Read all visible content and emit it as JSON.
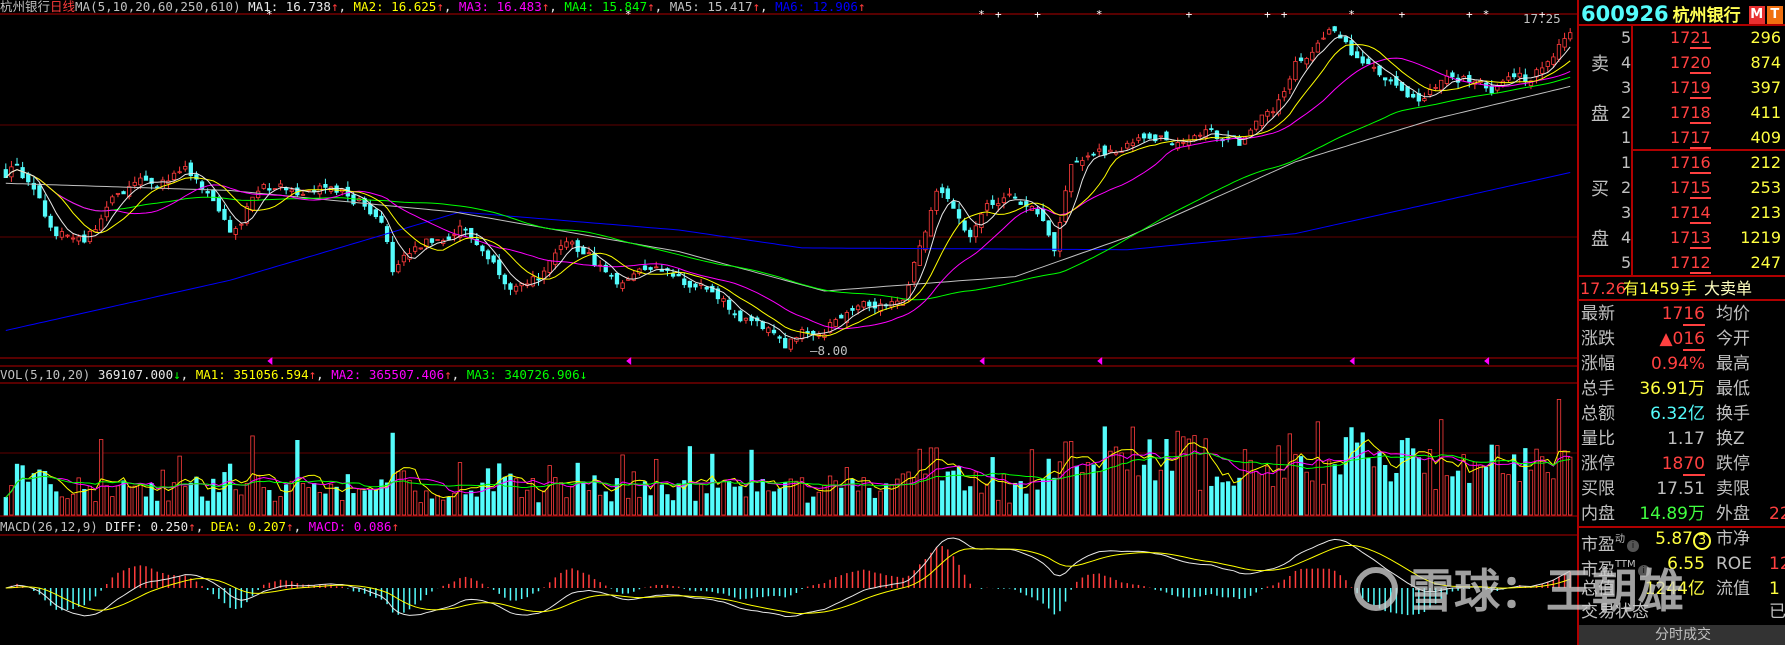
{
  "main_header": {
    "stock_name": "杭州银行",
    "period": "日线",
    "ma_params": "MA(5,10,20,60,250,610)",
    "items": [
      {
        "label": "MA1: ",
        "value": "16.738",
        "arrow": "↑",
        "color": "#e8e8e8"
      },
      {
        "label": "MA2: ",
        "value": "16.625",
        "arrow": "↑",
        "color": "#ffff00"
      },
      {
        "label": "MA3: ",
        "value": "16.483",
        "arrow": "↑",
        "color": "#ff00ff"
      },
      {
        "label": "MA4: ",
        "value": "15.847",
        "arrow": "↑",
        "color": "#00ff00"
      },
      {
        "label": "MA5: ",
        "value": "15.417",
        "arrow": "↑",
        "color": "#c0c0c0"
      },
      {
        "label": "MA6: ",
        "value": "12.906",
        "arrow": "↑",
        "color": "#0000ff"
      }
    ],
    "high_label": "17.25",
    "low_label": "8.00"
  },
  "vol_header": {
    "params": "VOL(5,10,20)",
    "value": "369107.000",
    "value_arrow": "↓",
    "items": [
      {
        "label": "MA1: ",
        "value": "351056.594",
        "arrow": "↑",
        "color": "#ffff00"
      },
      {
        "label": "MA2: ",
        "value": "365507.406",
        "arrow": "↑",
        "color": "#ff00ff"
      },
      {
        "label": "MA3: ",
        "value": "340726.906",
        "arrow": "↓",
        "color": "#00ff00"
      }
    ]
  },
  "macd_header": {
    "params": "MACD(26,12,9)",
    "items": [
      {
        "label": "DIFF: ",
        "value": "0.250",
        "arrow": "↑",
        "color": "#e8e8e8"
      },
      {
        "label": "DEA: ",
        "value": "0.207",
        "arrow": "↑",
        "color": "#ffff00"
      },
      {
        "label": "MACD: ",
        "value": "0.086",
        "arrow": "↑",
        "color": "#ff00ff"
      }
    ]
  },
  "chart_data": {
    "type": "candlestick",
    "bars": 280,
    "price_min": 8.0,
    "price_max": 17.25,
    "close_keypoints": [
      [
        0,
        13.0
      ],
      [
        2,
        13.3
      ],
      [
        8,
        11.4
      ],
      [
        14,
        10.95
      ],
      [
        20,
        12.4
      ],
      [
        32,
        13.0
      ],
      [
        40,
        11.4
      ],
      [
        46,
        12.7
      ],
      [
        58,
        12.5
      ],
      [
        67,
        11.9
      ],
      [
        69,
        10.3
      ],
      [
        81,
        11.6
      ],
      [
        89,
        10.15
      ],
      [
        93,
        9.7
      ],
      [
        101,
        10.95
      ],
      [
        109,
        10.0
      ],
      [
        115,
        10.5
      ],
      [
        125,
        9.7
      ],
      [
        133,
        8.7
      ],
      [
        139,
        8.25
      ],
      [
        146,
        8.7
      ],
      [
        152,
        9.5
      ],
      [
        160,
        9.5
      ],
      [
        166,
        12.5
      ],
      [
        172,
        11.4
      ],
      [
        178,
        12.5
      ],
      [
        184,
        11.9
      ],
      [
        187,
        10.95
      ],
      [
        190,
        13.3
      ],
      [
        202,
        13.8
      ],
      [
        214,
        14.1
      ],
      [
        220,
        13.8
      ],
      [
        226,
        14.6
      ],
      [
        230,
        16.0
      ],
      [
        236,
        16.8
      ],
      [
        241,
        16.2
      ],
      [
        251,
        14.9
      ],
      [
        257,
        15.7
      ],
      [
        265,
        15.4
      ],
      [
        271,
        15.5
      ],
      [
        276,
        16.5
      ],
      [
        279,
        17.0
      ]
    ],
    "ma250_keypoints": [
      [
        0,
        12.7
      ],
      [
        40,
        12.5
      ],
      [
        80,
        11.9
      ],
      [
        120,
        10.8
      ],
      [
        146,
        9.7
      ],
      [
        180,
        10.1
      ],
      [
        200,
        11.2
      ],
      [
        230,
        13.3
      ],
      [
        255,
        14.5
      ],
      [
        279,
        15.4
      ]
    ],
    "ma610_keypoints": [
      [
        0,
        8.6
      ],
      [
        40,
        10.0
      ],
      [
        81,
        11.9
      ],
      [
        120,
        11.4
      ],
      [
        142,
        10.9
      ],
      [
        200,
        10.85
      ],
      [
        230,
        11.3
      ],
      [
        279,
        13.0
      ]
    ],
    "top_markers": [
      [
        47,
        "*"
      ],
      [
        111,
        "*"
      ],
      [
        174,
        "*"
      ],
      [
        177,
        "+"
      ],
      [
        184,
        "+"
      ],
      [
        195,
        "*"
      ],
      [
        211,
        "+"
      ],
      [
        225,
        "+"
      ],
      [
        228,
        "+"
      ],
      [
        240,
        "*"
      ],
      [
        249,
        "+"
      ],
      [
        261,
        "+"
      ],
      [
        264,
        "*"
      ],
      [
        274,
        "+"
      ]
    ],
    "colors": {
      "up": "#ff3c3c",
      "down": "#54fcfc",
      "ma5": "#e8e8e8",
      "ma10": "#ffff00",
      "ma20": "#ff00ff",
      "ma60": "#00ff00",
      "ma250": "#c0c0c0",
      "ma610": "#0000ff"
    }
  },
  "panel": {
    "code": "600926",
    "name": "杭州银行",
    "badges": [
      {
        "text": "M",
        "color": "#e83030"
      },
      {
        "text": "T",
        "color": "#f07010"
      }
    ],
    "sell_label": [
      "卖",
      "盘"
    ],
    "buy_label": [
      "买",
      "盘"
    ],
    "sell": [
      {
        "n": "5",
        "p_hi": "17",
        "p_lo": "21",
        "v": "296"
      },
      {
        "n": "4",
        "p_hi": "17",
        "p_lo": "20",
        "v": "874"
      },
      {
        "n": "3",
        "p_hi": "17",
        "p_lo": "19",
        "v": "397"
      },
      {
        "n": "2",
        "p_hi": "17",
        "p_lo": "18",
        "v": "411"
      },
      {
        "n": "1",
        "p_hi": "17",
        "p_lo": "17",
        "v": "409"
      }
    ],
    "buy": [
      {
        "n": "1",
        "p_hi": "17",
        "p_lo": "16",
        "v": "212"
      },
      {
        "n": "2",
        "p_hi": "17",
        "p_lo": "15",
        "v": "253"
      },
      {
        "n": "3",
        "p_hi": "17",
        "p_lo": "14",
        "v": "213"
      },
      {
        "n": "4",
        "p_hi": "17",
        "p_lo": "13",
        "v": "1219"
      },
      {
        "n": "5",
        "p_hi": "17",
        "p_lo": "12",
        "v": "247"
      }
    ],
    "big_order": {
      "price": "17.26",
      "has": "有",
      "qty": "1459",
      "unit": "手",
      "type": "大卖单"
    },
    "stats": [
      {
        "label": "最新",
        "v_pre": "17",
        "v_u": "16",
        "color": "#ff4040",
        "right": "均价",
        "cut": ""
      },
      {
        "label": "涨跌",
        "v_pre": "▲0",
        "v_u": "16",
        "color": "#ff4040",
        "right": "今开",
        "cut": ""
      },
      {
        "label": "涨幅",
        "v_pre": "0.94%",
        "v_u": "",
        "color": "#ff4040",
        "right": "最高",
        "cut": ""
      },
      {
        "label": "总手",
        "v_pre": "36.91万",
        "v_u": "",
        "color": "#ffff40",
        "right": "最低",
        "cut": ""
      },
      {
        "label": "总额",
        "v_pre": "6.32亿",
        "v_u": "",
        "color": "#54fcfc",
        "right": "换手",
        "cut": ""
      },
      {
        "label": "量比",
        "v_pre": "1.17",
        "v_u": "",
        "color": "#c0c0c0",
        "right": " 换Z",
        "cut": ""
      },
      {
        "label": "涨停",
        "v_pre": "18",
        "v_u": "70",
        "color": "#ff4040",
        "right": "跌停",
        "cut": ""
      },
      {
        "label": "买限",
        "v_pre": "17.51",
        "v_u": "",
        "color": "#c0c0c0",
        "right": "卖限",
        "cut": ""
      },
      {
        "label": "内盘",
        "v_pre": "14.89万",
        "v_u": "",
        "color": "#40ff40",
        "right": "外盘",
        "cut": "22"
      }
    ],
    "pe_dynamic": {
      "label": "市盈",
      "sup": "动",
      "value": "5.87",
      "rank": "3",
      "right": "市净"
    },
    "pe_ttm": {
      "label": "市盈",
      "sup": "TTM",
      "value": "6.55",
      "right": "ROE",
      "cut": "12"
    },
    "total_value": {
      "label": "总值",
      "value": "1244亿",
      "right": "流值",
      "cut": "1"
    },
    "trade_status": {
      "label": "交易状态",
      "cut": "已"
    },
    "bottom_tab": "分时成交"
  },
  "watermark": "雪球：王朝雄"
}
